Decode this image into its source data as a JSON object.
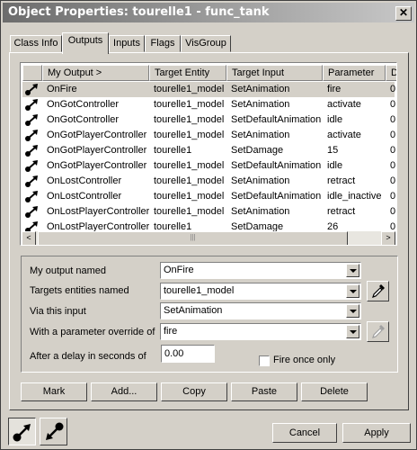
{
  "window": {
    "title": "Object Properties: tourelle1 - func_tank",
    "close_glyph": "✕"
  },
  "tabs": [
    {
      "label": "Class Info"
    },
    {
      "label": "Outputs"
    },
    {
      "label": "Inputs"
    },
    {
      "label": "Flags"
    },
    {
      "label": "VisGroup"
    }
  ],
  "grid": {
    "columns": [
      "My Output  >",
      "Target Entity",
      "Target Input",
      "Parameter",
      "D"
    ],
    "rows": [
      {
        "output": "OnFire",
        "target": "tourelle1_model",
        "input": "SetAnimation",
        "param": "fire",
        "delay": "0"
      },
      {
        "output": "OnGotController",
        "target": "tourelle1_model",
        "input": "SetAnimation",
        "param": "activate",
        "delay": "0"
      },
      {
        "output": "OnGotController",
        "target": "tourelle1_model",
        "input": "SetDefaultAnimation",
        "param": "idle",
        "delay": "0"
      },
      {
        "output": "OnGotPlayerController",
        "target": "tourelle1_model",
        "input": "SetAnimation",
        "param": "activate",
        "delay": "0"
      },
      {
        "output": "OnGotPlayerController",
        "target": "tourelle1",
        "input": "SetDamage",
        "param": "15",
        "delay": "0"
      },
      {
        "output": "OnGotPlayerController",
        "target": "tourelle1_model",
        "input": "SetDefaultAnimation",
        "param": "idle",
        "delay": "0"
      },
      {
        "output": "OnLostController",
        "target": "tourelle1_model",
        "input": "SetAnimation",
        "param": "retract",
        "delay": "0"
      },
      {
        "output": "OnLostController",
        "target": "tourelle1_model",
        "input": "SetDefaultAnimation",
        "param": "idle_inactive",
        "delay": "0"
      },
      {
        "output": "OnLostPlayerController",
        "target": "tourelle1_model",
        "input": "SetAnimation",
        "param": "retract",
        "delay": "0"
      },
      {
        "output": "OnLostPlayerController",
        "target": "tourelle1",
        "input": "SetDamage",
        "param": "26",
        "delay": "0"
      }
    ],
    "scroll_left": "<",
    "scroll_right": ">",
    "thumb_grip": "|||"
  },
  "form": {
    "output_label": "My output named",
    "output_value": "OnFire",
    "target_label": "Targets entities named",
    "target_value": "tourelle1_model",
    "input_label": "Via this input",
    "input_value": "SetAnimation",
    "param_label": "With a parameter override of",
    "param_value": "fire",
    "delay_label": "After a delay in seconds of",
    "delay_value": "0.00",
    "fire_once_label": "Fire once only",
    "fire_once_checked": false
  },
  "actions": {
    "mark": "Mark",
    "add": "Add...",
    "copy": "Copy",
    "paste": "Paste",
    "delete": "Delete"
  },
  "footer": {
    "cancel": "Cancel",
    "apply": "Apply"
  }
}
